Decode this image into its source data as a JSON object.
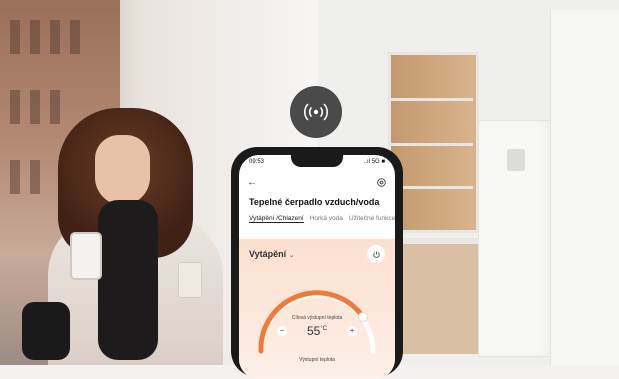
{
  "phone": {
    "status_time": "09:53",
    "status_icons": "..ıl 5G ■",
    "title": "Tepelné čerpadlo vzduch/voda",
    "tabs": [
      {
        "label": "Vytápění /Chlazení",
        "active": true
      },
      {
        "label": "Horká voda",
        "active": false
      },
      {
        "label": "Užitečné funkce",
        "active": false
      }
    ],
    "card": {
      "mode_label": "Vytápění",
      "target_label": "Cílová výstupní teplota",
      "target_value": "55",
      "target_unit": "°C",
      "minus_label": "−",
      "plus_label": "+",
      "output_label": "Výstupní teplota"
    }
  },
  "colors": {
    "gauge_arc": "#f07a3a",
    "card_bg": "#fbe0d0"
  },
  "icons": {
    "wireless": "wireless-signal-icon",
    "back": "arrow-left-icon",
    "settings": "gear-icon",
    "power": "power-icon"
  }
}
